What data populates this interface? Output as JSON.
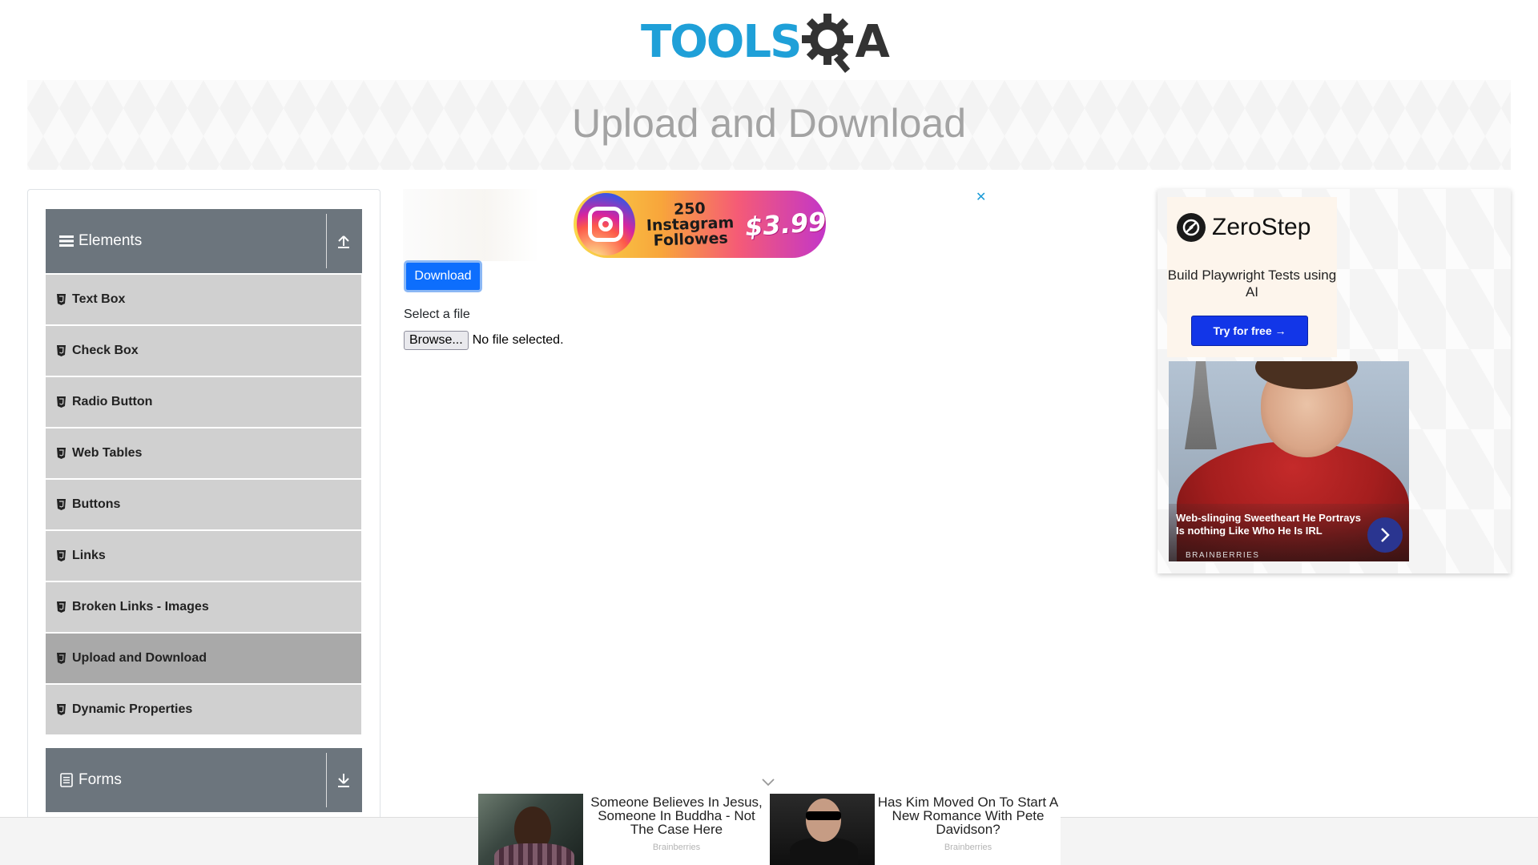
{
  "logo": {
    "part1": "TOOLS",
    "part2": "A"
  },
  "banner": {
    "title": "Upload and Download"
  },
  "sidebar": {
    "groups": [
      {
        "label": "Elements",
        "expanded": true
      },
      {
        "label": "Forms",
        "expanded": false
      }
    ],
    "items": [
      {
        "label": "Text Box"
      },
      {
        "label": "Check Box"
      },
      {
        "label": "Radio Button"
      },
      {
        "label": "Web Tables"
      },
      {
        "label": "Buttons"
      },
      {
        "label": "Links"
      },
      {
        "label": "Broken Links - Images"
      },
      {
        "label": "Upload and Download",
        "active": true
      },
      {
        "label": "Dynamic Properties"
      }
    ]
  },
  "top_ad": {
    "line1": "250 Instagram",
    "line2": "Followes",
    "price": "$3.99",
    "close": "✕"
  },
  "main": {
    "download_label": "Download",
    "select_file_label": "Select a file",
    "browse_label": "Browse...",
    "file_status": "No file selected."
  },
  "right_ad": {
    "brand": "ZeroStep",
    "tagline": "Build Playwright Tests using AI",
    "cta": "Try for free →",
    "caption": "Web-slinging Sweetheart He Portrays Is nothing Like Who He Is IRL",
    "source": "BRAINBERRIES"
  },
  "bottom_ads": [
    {
      "title": "Someone Believes In Jesus, Someone In Buddha - Not The Case Here",
      "source": "Brainberries"
    },
    {
      "title": "Has Kim Moved On To Start A New Romance With Pete Davidson?",
      "source": "Brainberries"
    }
  ],
  "colors": {
    "accent": "#0d6efd",
    "sidebar_header": "#6c757d",
    "menu_item": "#d0d0d0",
    "menu_item_active": "#a9a9a9",
    "logo_blue": "#1fa0d8"
  }
}
